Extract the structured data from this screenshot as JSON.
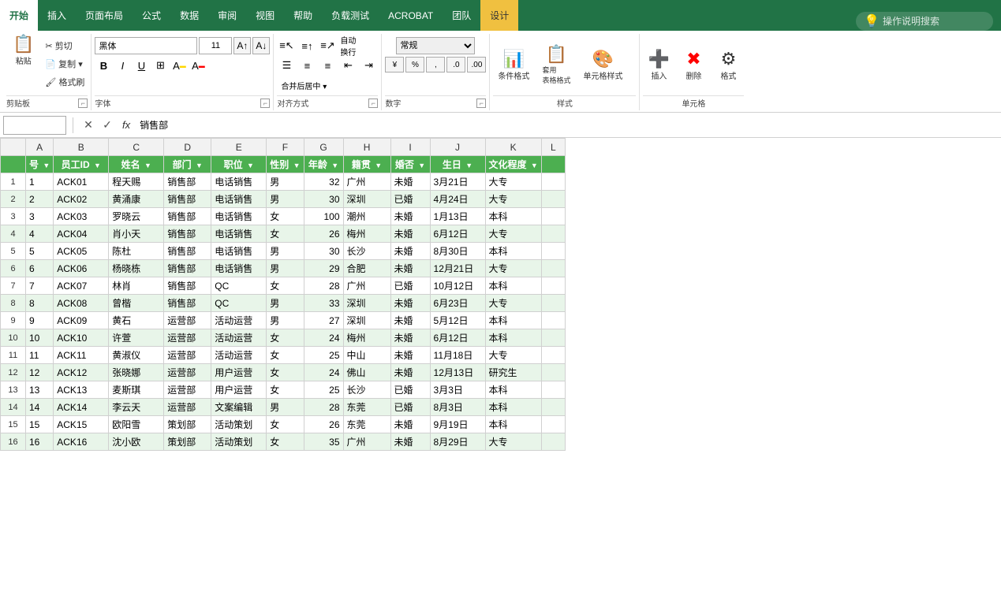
{
  "ribbon": {
    "tabs": [
      "开始",
      "插入",
      "页面布局",
      "公式",
      "数据",
      "审阅",
      "视图",
      "帮助",
      "负载测试",
      "ACROBAT",
      "团队",
      "设计"
    ],
    "active_tab": "开始",
    "search_placeholder": "操作说明搜索",
    "clipboard": {
      "cut": "剪切",
      "copy": "复制 ▾",
      "paste_format": "格式刷"
    },
    "font": {
      "name": "黑体",
      "size": "11",
      "bold": "B",
      "italic": "I",
      "underline": "U",
      "label": "字体"
    },
    "alignment": {
      "label": "对齐方式",
      "wrap": "自动换行",
      "merge": "合并后居中 ▾"
    },
    "number": {
      "format": "常规",
      "label": "数字",
      "percent": "%",
      "comma": ",",
      "currency": "¥"
    },
    "styles": {
      "conditional": "条件格式",
      "table": "套用\n表格格式",
      "cell_style": "单元格样式",
      "label": "样式"
    },
    "cells": {
      "insert": "插入",
      "delete": "删除",
      "format": "格式",
      "label": "单元格"
    }
  },
  "formula_bar": {
    "name_box": "",
    "formula": "销售部"
  },
  "spreadsheet": {
    "col_headers": [
      "A",
      "B",
      "C",
      "D",
      "E",
      "F",
      "G",
      "H",
      "I",
      "J",
      "K",
      "L"
    ],
    "filter_row": {
      "headers": [
        "号 ▾",
        "员工ID ▾",
        "姓名 ▾",
        "部门 ▾",
        "职位 ▾",
        "性别 ▾",
        "年龄 ▾",
        "籍贯 ▾",
        "婚否 ▾",
        "生日 ▾",
        "文化程度 ▾",
        ""
      ]
    },
    "rows": [
      {
        "num": 1,
        "id": "ACK01",
        "name": "程天赐",
        "dept": "销售部",
        "pos": "电话销售",
        "gender": "男",
        "age": "32",
        "origin": "广州",
        "married": "未婚",
        "birth": "3月21日",
        "edu": "大专",
        "green": false
      },
      {
        "num": 2,
        "id": "ACK02",
        "name": "黄涌康",
        "dept": "销售部",
        "pos": "电话销售",
        "gender": "男",
        "age": "30",
        "origin": "深圳",
        "married": "已婚",
        "birth": "4月24日",
        "edu": "大专",
        "green": true
      },
      {
        "num": 3,
        "id": "ACK03",
        "name": "罗晓云",
        "dept": "销售部",
        "pos": "电话销售",
        "gender": "女",
        "age": "100",
        "origin": "潮州",
        "married": "未婚",
        "birth": "1月13日",
        "edu": "本科",
        "green": false
      },
      {
        "num": 4,
        "id": "ACK04",
        "name": "肖小天",
        "dept": "销售部",
        "pos": "电话销售",
        "gender": "女",
        "age": "26",
        "origin": "梅州",
        "married": "未婚",
        "birth": "6月12日",
        "edu": "大专",
        "green": true
      },
      {
        "num": 5,
        "id": "ACK05",
        "name": "陈杜",
        "dept": "销售部",
        "pos": "电话销售",
        "gender": "男",
        "age": "30",
        "origin": "长沙",
        "married": "未婚",
        "birth": "8月30日",
        "edu": "本科",
        "green": false
      },
      {
        "num": 6,
        "id": "ACK06",
        "name": "杨晓栋",
        "dept": "销售部",
        "pos": "电话销售",
        "gender": "男",
        "age": "29",
        "origin": "合肥",
        "married": "未婚",
        "birth": "12月21日",
        "edu": "大专",
        "green": true
      },
      {
        "num": 7,
        "id": "ACK07",
        "name": "林肖",
        "dept": "销售部",
        "pos": "QC",
        "gender": "女",
        "age": "28",
        "origin": "广州",
        "married": "已婚",
        "birth": "10月12日",
        "edu": "本科",
        "green": false
      },
      {
        "num": 8,
        "id": "ACK08",
        "name": "曾楷",
        "dept": "销售部",
        "pos": "QC",
        "gender": "男",
        "age": "33",
        "origin": "深圳",
        "married": "未婚",
        "birth": "6月23日",
        "edu": "大专",
        "green": true
      },
      {
        "num": 9,
        "id": "ACK09",
        "name": "黄石",
        "dept": "运营部",
        "pos": "活动运营",
        "gender": "男",
        "age": "27",
        "origin": "深圳",
        "married": "未婚",
        "birth": "5月12日",
        "edu": "本科",
        "green": false
      },
      {
        "num": 10,
        "id": "ACK10",
        "name": "许萱",
        "dept": "运营部",
        "pos": "活动运营",
        "gender": "女",
        "age": "24",
        "origin": "梅州",
        "married": "未婚",
        "birth": "6月12日",
        "edu": "本科",
        "green": true
      },
      {
        "num": 11,
        "id": "ACK11",
        "name": "黄淑仪",
        "dept": "运营部",
        "pos": "活动运营",
        "gender": "女",
        "age": "25",
        "origin": "中山",
        "married": "未婚",
        "birth": "11月18日",
        "edu": "大专",
        "green": false
      },
      {
        "num": 12,
        "id": "ACK12",
        "name": "张晓娜",
        "dept": "运营部",
        "pos": "用户运营",
        "gender": "女",
        "age": "24",
        "origin": "佛山",
        "married": "未婚",
        "birth": "12月13日",
        "edu": "研究生",
        "green": true
      },
      {
        "num": 13,
        "id": "ACK13",
        "name": "麦斯琪",
        "dept": "运营部",
        "pos": "用户运营",
        "gender": "女",
        "age": "25",
        "origin": "长沙",
        "married": "已婚",
        "birth": "3月3日",
        "edu": "本科",
        "green": false
      },
      {
        "num": 14,
        "id": "ACK14",
        "name": "李云天",
        "dept": "运营部",
        "pos": "文案编辑",
        "gender": "男",
        "age": "28",
        "origin": "东莞",
        "married": "已婚",
        "birth": "8月3日",
        "edu": "本科",
        "green": true
      },
      {
        "num": 15,
        "id": "ACK15",
        "name": "欧阳雪",
        "dept": "策划部",
        "pos": "活动策划",
        "gender": "女",
        "age": "26",
        "origin": "东莞",
        "married": "未婚",
        "birth": "9月19日",
        "edu": "本科",
        "green": false
      },
      {
        "num": 16,
        "id": "ACK16",
        "name": "沈小欧",
        "dept": "策划部",
        "pos": "活动策划",
        "gender": "女",
        "age": "35",
        "origin": "广州",
        "married": "未婚",
        "birth": "8月29日",
        "edu": "大专",
        "green": true
      }
    ]
  },
  "colors": {
    "ribbon_bg": "#217346",
    "active_tab_bg": "#ffffff",
    "filter_header_bg": "#4CAF50",
    "green_row_bg": "#e8f5e9"
  }
}
